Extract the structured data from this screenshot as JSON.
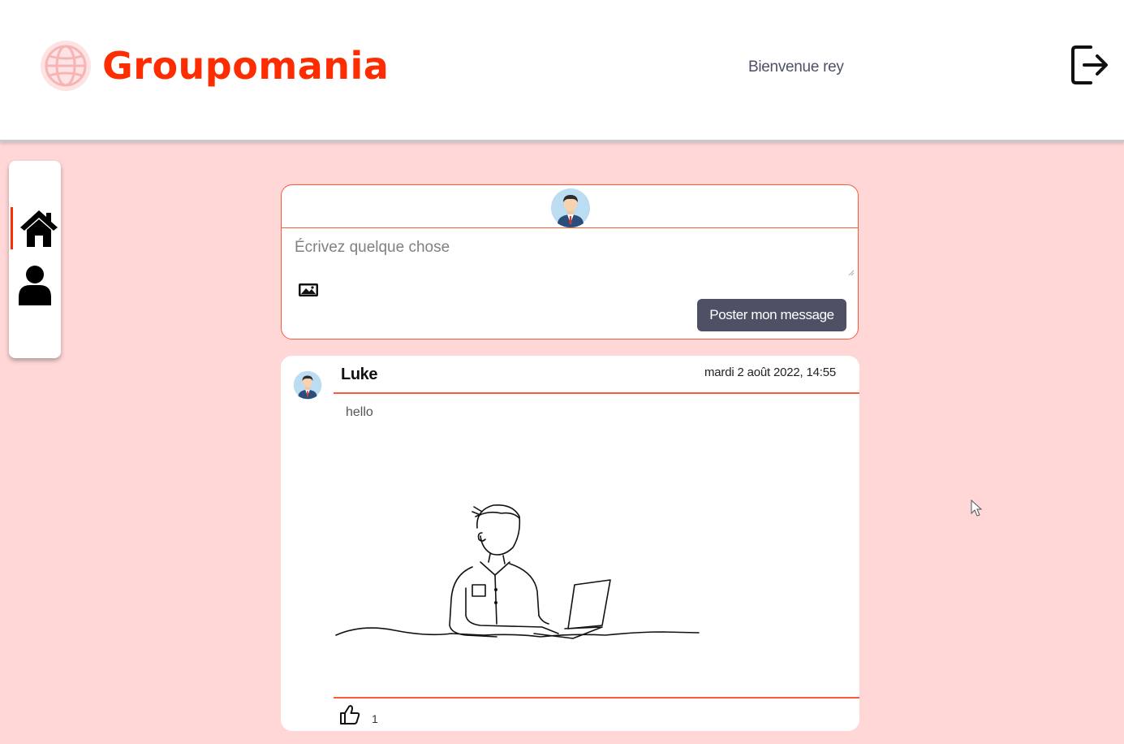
{
  "header": {
    "brand": "Groupomania",
    "welcome": "Bienvenue rey",
    "logout_icon": "logout-icon"
  },
  "sidebar": {
    "items": [
      {
        "name": "home",
        "icon": "home-icon",
        "active": true
      },
      {
        "name": "profile",
        "icon": "user-icon",
        "active": false
      }
    ]
  },
  "composer": {
    "placeholder": "Écrivez quelque chose",
    "image_icon": "image-icon",
    "post_label": "Poster mon message"
  },
  "posts": [
    {
      "author": "Luke",
      "date": "mardi 2 août 2022, 14:55",
      "text": "hello",
      "likes": "1",
      "image": "line-drawing-man-with-laptop"
    }
  ],
  "colors": {
    "brand": "#fd2d01",
    "background": "#ffd7d7",
    "button": "#4e5166",
    "border": "#fd5a3a"
  }
}
